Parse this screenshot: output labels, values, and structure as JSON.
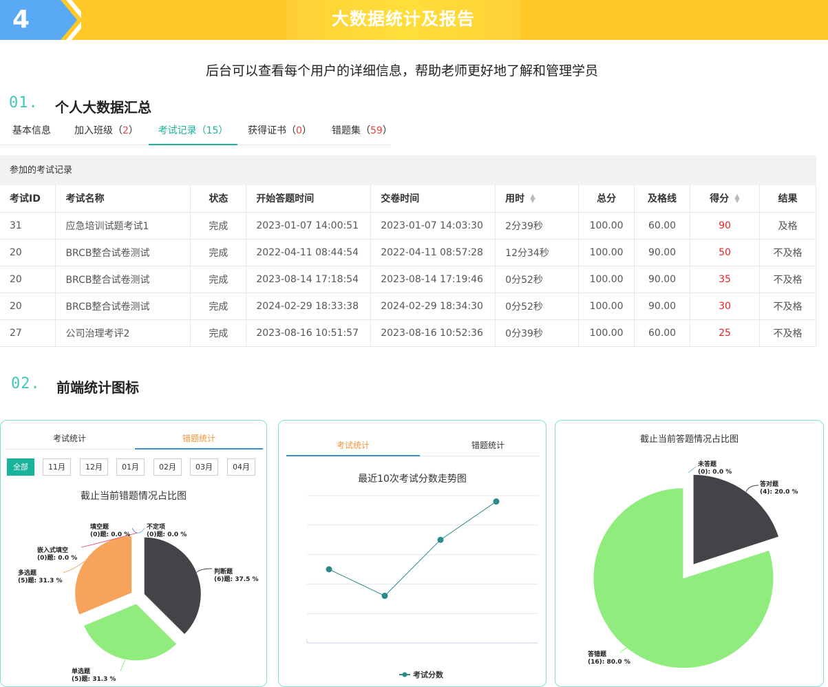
{
  "banner": {
    "number": "4",
    "title": "大数据统计及报告"
  },
  "subtitle": "后台可以查看每个用户的详细信息，帮助老师更好地了解和管理学员",
  "section1": {
    "num": "01.",
    "title": "个人大数据汇总"
  },
  "tabs": [
    {
      "label": "基本信息",
      "count": ""
    },
    {
      "label": "加入班级",
      "count": "2"
    },
    {
      "label": "考试记录",
      "count": "15"
    },
    {
      "label": "获得证书",
      "count": "0"
    },
    {
      "label": "错题集",
      "count": "59"
    }
  ],
  "table": {
    "caption": "参加的考试记录",
    "headers": [
      "考试ID",
      "考试名称",
      "状态",
      "开始答题时间",
      "交卷时间",
      "用时",
      "总分",
      "及格线",
      "得分",
      "结果"
    ],
    "rows": [
      [
        "31",
        "应急培训试题考试1",
        "完成",
        "2023-01-07 14:00:51",
        "2023-01-07 14:03:30",
        "2分39秒",
        "100.00",
        "60.00",
        "90",
        "及格"
      ],
      [
        "20",
        "BRCB整合试卷测试",
        "完成",
        "2022-04-11 08:44:54",
        "2022-04-11 08:57:28",
        "12分34秒",
        "100.00",
        "90.00",
        "50",
        "不及格"
      ],
      [
        "20",
        "BRCB整合试卷测试",
        "完成",
        "2023-08-14 17:18:54",
        "2023-08-14 17:19:46",
        "0分52秒",
        "100.00",
        "90.00",
        "35",
        "不及格"
      ],
      [
        "20",
        "BRCB整合试卷测试",
        "完成",
        "2024-02-29 18:33:38",
        "2024-02-29 18:34:30",
        "0分52秒",
        "100.00",
        "90.00",
        "30",
        "不及格"
      ],
      [
        "27",
        "公司治理考评2",
        "完成",
        "2023-08-16 10:51:57",
        "2023-08-16 10:52:36",
        "0分39秒",
        "100.00",
        "60.00",
        "25",
        "不及格"
      ]
    ]
  },
  "section2": {
    "num": "02.",
    "title": "前端统计图标"
  },
  "card1": {
    "tabs": [
      "考试统计",
      "错题统计"
    ],
    "months": [
      "全部",
      "11月",
      "12月",
      "01月",
      "02月",
      "03月",
      "04月"
    ]
  },
  "card2": {
    "tabs": [
      "考试统计",
      "错题统计"
    ]
  },
  "colors": {
    "accent": "#19b39b",
    "banner": "#ffc827",
    "blue": "#5aa9f5",
    "dark": "#434348",
    "green": "#90ed7d",
    "orange": "#f7a35c",
    "line": "#2a8a8a"
  },
  "chart_data": [
    {
      "type": "pie",
      "title": "截止当前错题情况占比图",
      "slices": [
        {
          "label": "判断题",
          "count_text": "(6)题: 37.5 %",
          "value": 37.5,
          "color": "#434348"
        },
        {
          "label": "单选题",
          "count_text": "(5)题: 31.3 %",
          "value": 31.3,
          "color": "#90ed7d"
        },
        {
          "label": "多选题",
          "count_text": "(5)题: 31.3 %",
          "value": 31.3,
          "color": "#f7a35c"
        },
        {
          "label": "嵌入式填空",
          "count_text": "(0)题: 0.0 %",
          "value": 0,
          "color": "#f15c80"
        },
        {
          "label": "填空题",
          "count_text": "(0)题: 0.0 %",
          "value": 0,
          "color": "#8085e9"
        },
        {
          "label": "不定项",
          "count_text": "(0)题: 0.0 %",
          "value": 0,
          "color": "#7cb5ec"
        }
      ]
    },
    {
      "type": "line",
      "title": "最近10次考试分数走势图",
      "series": [
        {
          "name": "考试分数",
          "values": [
            25,
            16,
            35,
            48
          ]
        }
      ],
      "ylim": [
        0,
        50
      ],
      "grid": true,
      "legend": "bottom"
    },
    {
      "type": "pie",
      "title": "截止当前答题情况占比图",
      "slices": [
        {
          "label": "答对题",
          "count_text": "(4): 20.0 %",
          "value": 20,
          "color": "#434348"
        },
        {
          "label": "答错题",
          "count_text": "(16): 80.0 %",
          "value": 80,
          "color": "#90ed7d"
        },
        {
          "label": "未答题",
          "count_text": "(0): 0.0 %",
          "value": 0,
          "color": "#7cb5ec"
        }
      ]
    }
  ]
}
